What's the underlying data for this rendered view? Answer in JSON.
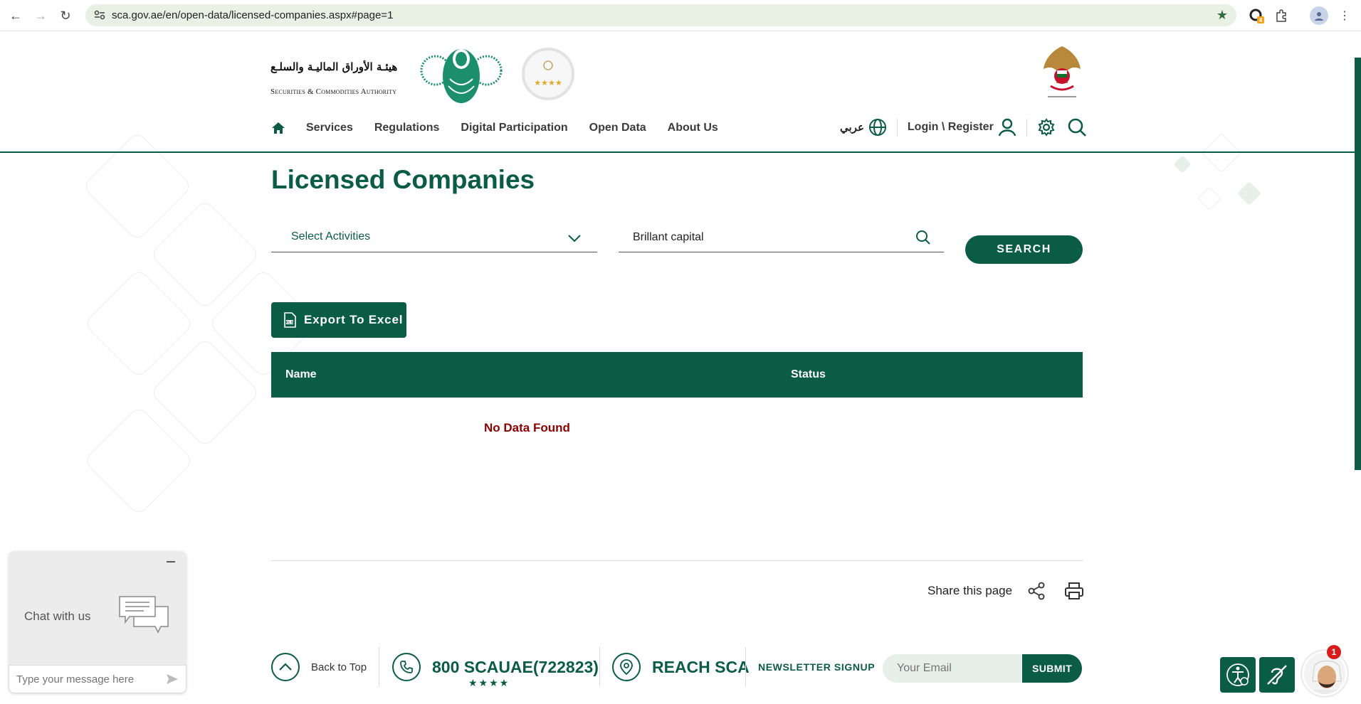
{
  "browser": {
    "url": "sca.gov.ae/en/open-data/licensed-companies.aspx#page=1",
    "extension_badge": "4"
  },
  "header": {
    "logo_ar": "هيئـة الأوراق الماليـة والسلـع",
    "logo_en": "Securities & Commodities Authority",
    "nav": [
      "Services",
      "Regulations",
      "Digital Participation",
      "Open Data",
      "About Us"
    ],
    "lang": "عربي",
    "login": "Login \\ Register"
  },
  "main": {
    "title": "Licensed Companies",
    "activities_select": "Select Activities",
    "search_value": "Brillant capital",
    "search_button": "SEARCH",
    "export_button": "Export To Excel",
    "table_headers": [
      "Name",
      "Status"
    ],
    "empty_message": "No Data Found",
    "share_text": "Share this page"
  },
  "footer": {
    "back_to_top": "Back to Top",
    "phone": "800 SCAUAE(722823)",
    "phone_stars": "★★★★",
    "reach": "REACH SCA",
    "newsletter": "NEWSLETTER SIGNUP",
    "email_placeholder": "Your Email",
    "submit": "SUBMIT"
  },
  "chat": {
    "label": "Chat with us",
    "placeholder": "Type your message here"
  },
  "assistant": {
    "badge": "1"
  },
  "colors": {
    "brand": "#0a5c45",
    "error": "#8b0000"
  }
}
